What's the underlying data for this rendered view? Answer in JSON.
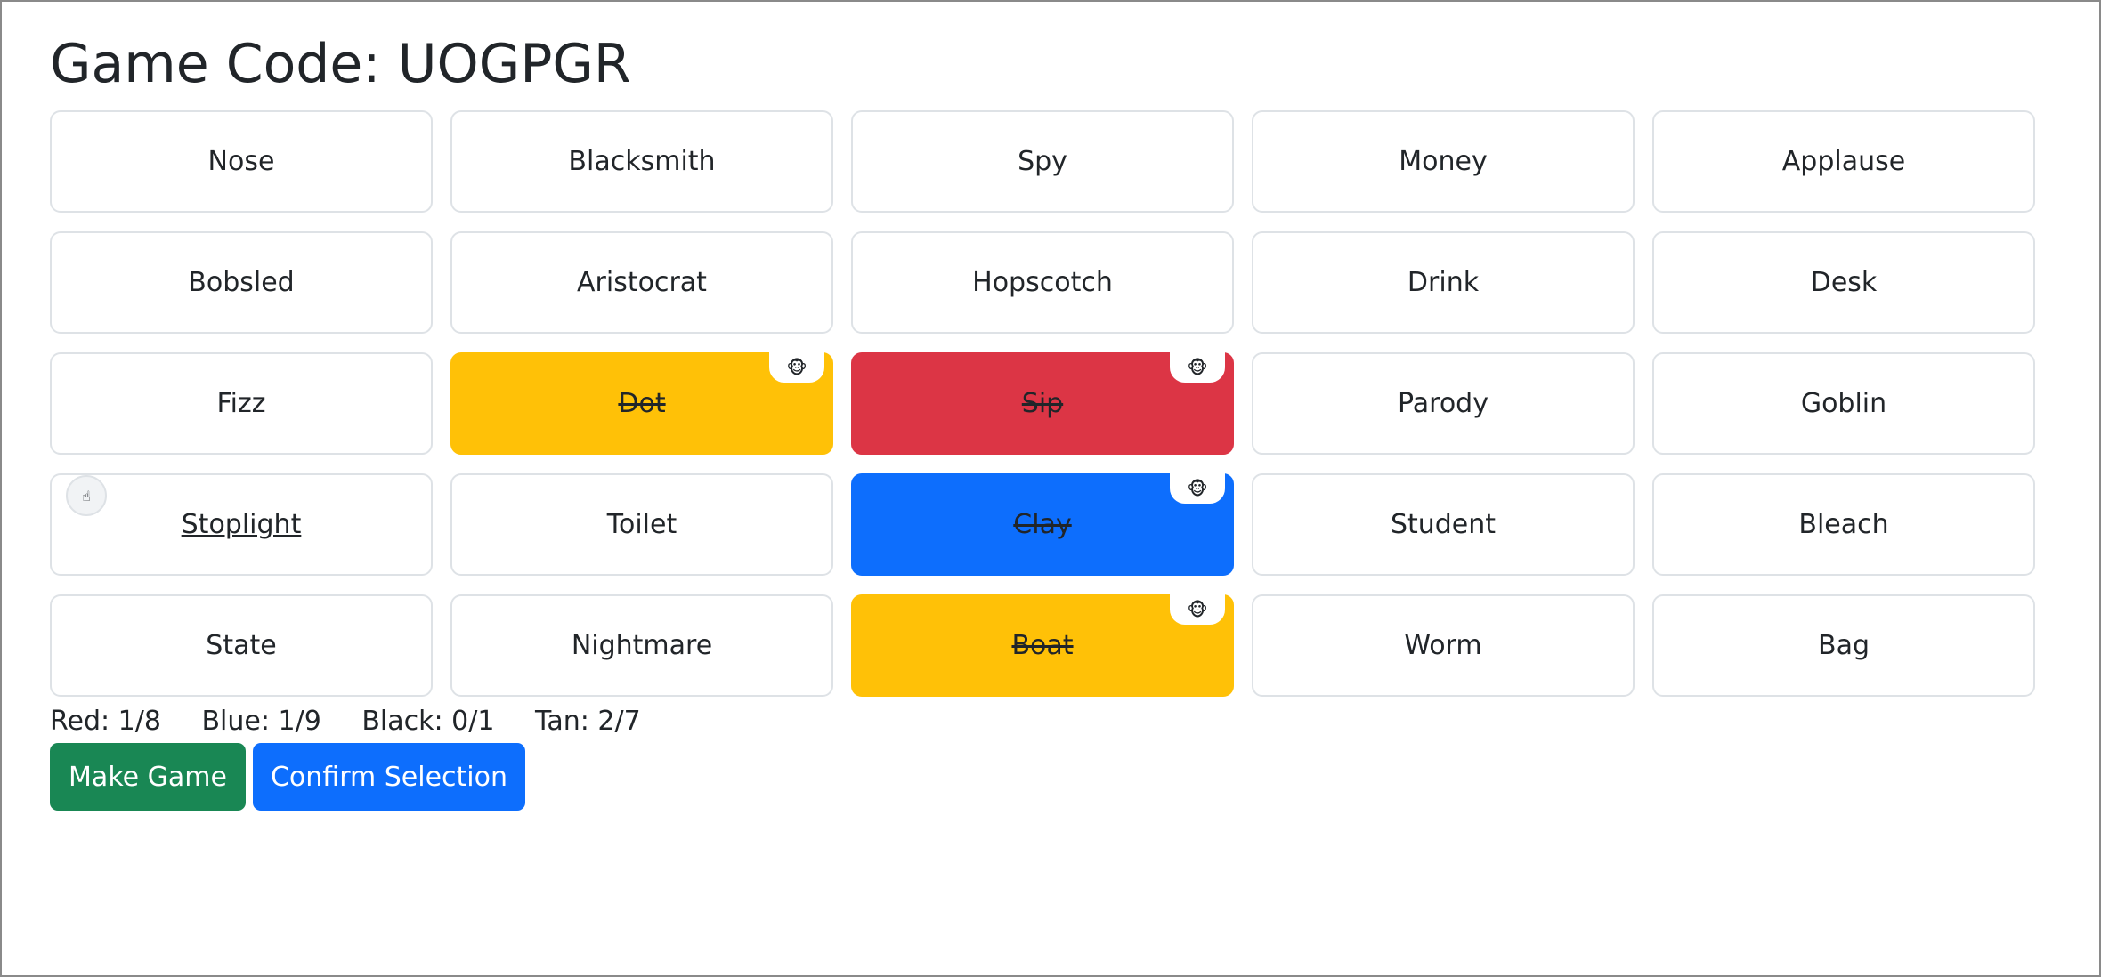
{
  "header": {
    "title": "Game Code: UOGPGR"
  },
  "cards": [
    {
      "word": "Nose",
      "color": "",
      "revealed": false,
      "badge": "",
      "marker": ""
    },
    {
      "word": "Blacksmith",
      "color": "",
      "revealed": false,
      "badge": "",
      "marker": ""
    },
    {
      "word": "Spy",
      "color": "",
      "revealed": false,
      "badge": "",
      "marker": ""
    },
    {
      "word": "Money",
      "color": "",
      "revealed": false,
      "badge": "",
      "marker": ""
    },
    {
      "word": "Applause",
      "color": "",
      "revealed": false,
      "badge": "",
      "marker": ""
    },
    {
      "word": "Bobsled",
      "color": "",
      "revealed": false,
      "badge": "",
      "marker": ""
    },
    {
      "word": "Aristocrat",
      "color": "",
      "revealed": false,
      "badge": "",
      "marker": ""
    },
    {
      "word": "Hopscotch",
      "color": "",
      "revealed": false,
      "badge": "",
      "marker": ""
    },
    {
      "word": "Drink",
      "color": "",
      "revealed": false,
      "badge": "",
      "marker": ""
    },
    {
      "word": "Desk",
      "color": "",
      "revealed": false,
      "badge": "",
      "marker": ""
    },
    {
      "word": "Fizz",
      "color": "",
      "revealed": false,
      "badge": "",
      "marker": ""
    },
    {
      "word": "Dot",
      "color": "tan",
      "revealed": true,
      "badge": "🐵",
      "marker": ""
    },
    {
      "word": "Sip",
      "color": "red",
      "revealed": true,
      "badge": "🐵",
      "marker": ""
    },
    {
      "word": "Parody",
      "color": "",
      "revealed": false,
      "badge": "",
      "marker": ""
    },
    {
      "word": "Goblin",
      "color": "",
      "revealed": false,
      "badge": "",
      "marker": ""
    },
    {
      "word": "Stoplight",
      "color": "",
      "revealed": false,
      "selected": true,
      "badge": "",
      "marker": "☝"
    },
    {
      "word": "Toilet",
      "color": "",
      "revealed": false,
      "badge": "",
      "marker": ""
    },
    {
      "word": "Clay",
      "color": "blue",
      "revealed": true,
      "badge": "🐵",
      "marker": ""
    },
    {
      "word": "Student",
      "color": "",
      "revealed": false,
      "badge": "",
      "marker": ""
    },
    {
      "word": "Bleach",
      "color": "",
      "revealed": false,
      "badge": "",
      "marker": ""
    },
    {
      "word": "State",
      "color": "",
      "revealed": false,
      "badge": "",
      "marker": ""
    },
    {
      "word": "Nightmare",
      "color": "",
      "revealed": false,
      "badge": "",
      "marker": ""
    },
    {
      "word": "Boat",
      "color": "tan",
      "revealed": true,
      "badge": "🐵",
      "marker": ""
    },
    {
      "word": "Worm",
      "color": "",
      "revealed": false,
      "badge": "",
      "marker": ""
    },
    {
      "word": "Bag",
      "color": "",
      "revealed": false,
      "badge": "",
      "marker": ""
    }
  ],
  "scores": {
    "red": "Red: 1/8",
    "blue": "Blue: 1/9",
    "black": "Black: 0/1",
    "tan": "Tan: 2/7"
  },
  "actions": {
    "make_game": "Make Game",
    "confirm_selection": "Confirm Selection"
  },
  "colors": {
    "tan": "#ffc107",
    "red": "#dc3545",
    "blue": "#0d6efd",
    "green": "#198754"
  }
}
